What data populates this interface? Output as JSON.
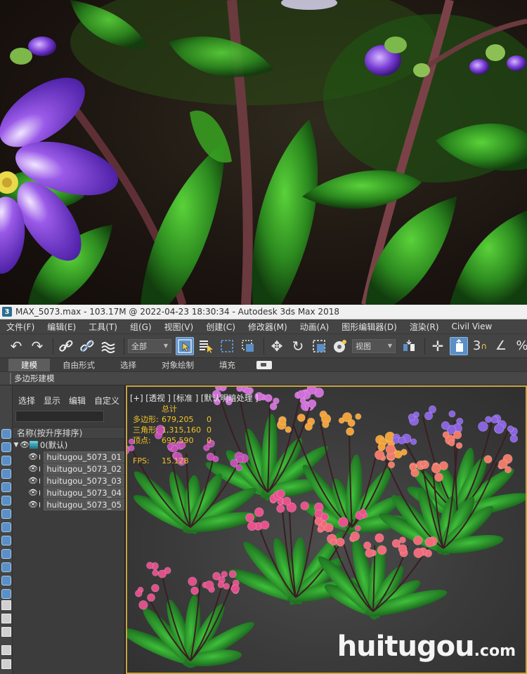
{
  "window": {
    "title": "MAX_5073.max - 103.17M @ 2022-04-23 18:30:34 - Autodesk 3ds Max 2018",
    "app_icon_label": "3"
  },
  "menubar": {
    "items": [
      "文件(F)",
      "编辑(E)",
      "工具(T)",
      "组(G)",
      "视图(V)",
      "创建(C)",
      "修改器(M)",
      "动画(A)",
      "图形编辑器(D)",
      "渲染(R)",
      "Civil View"
    ]
  },
  "toolbar": {
    "selection_filter": "全部",
    "reference_coord": "视图",
    "icons": [
      "undo-icon",
      "redo-icon",
      "link-icon",
      "unlink-icon",
      "bind-spacewarp-icon",
      "select-object-icon",
      "select-by-name-icon",
      "rect-region-icon",
      "window-crossing-icon",
      "move-icon",
      "rotate-icon",
      "scale-icon",
      "select-manipulate-icon",
      "pivot-icon",
      "snap-icon",
      "angle-snap-icon",
      "percent-snap-icon"
    ]
  },
  "ribbon": {
    "tabs": [
      "建模",
      "自由形式",
      "选择",
      "对象绘制",
      "填充"
    ],
    "active_tab": "建模",
    "panel_label": "多边形建模"
  },
  "explorer": {
    "menu": [
      "选择",
      "显示",
      "编辑",
      "自定义"
    ],
    "header": "名称(按升序排序)",
    "layer": "0(默认)",
    "objects": [
      "huitugou_5073_01",
      "huitugou_5073_02",
      "huitugou_5073_03",
      "huitugou_5073_04",
      "huitugou_5073_05"
    ]
  },
  "viewport": {
    "label": "[+] [透视 ] [标准 ] [默认明暗处理 ]",
    "stats": {
      "total_label": "总计",
      "polygons_label": "多边形:",
      "polygons_value": "679,205",
      "polygons_sel": "0",
      "triangles_label": "三角形:",
      "triangles_value": "1,315,160",
      "triangles_sel": "0",
      "vertices_label": "顶点:",
      "vertices_value": "695,590",
      "vertices_sel": "0",
      "fps_label": "FPS:",
      "fps_value": "15.128"
    },
    "watermark_main": "huitugou",
    "watermark_suffix": ".com"
  },
  "colors": {
    "accent_active": "#5b8fc6",
    "viewport_border": "#c9a441",
    "stats_text": "#f0c52a"
  }
}
